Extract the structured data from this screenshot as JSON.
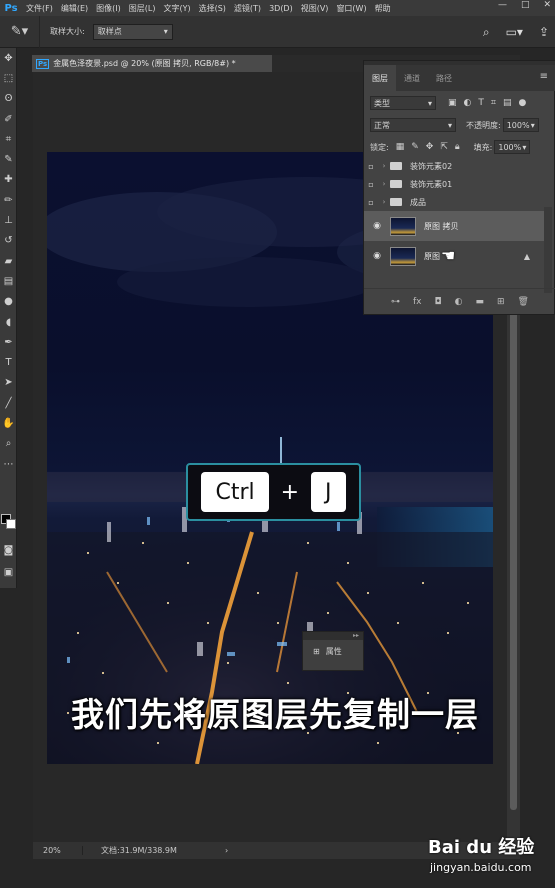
{
  "app": {
    "logo": "Ps",
    "menu": [
      "文件(F)",
      "编辑(E)",
      "图像(I)",
      "图层(L)",
      "文字(Y)",
      "选择(S)",
      "滤镜(T)",
      "3D(D)",
      "视图(V)",
      "窗口(W)",
      "帮助"
    ],
    "window_controls": [
      "—",
      "□",
      "✕"
    ]
  },
  "options_bar": {
    "tool_icon": "eyedropper-icon",
    "sample_size_label": "取样大小:",
    "sample_size_value": "取样点",
    "right_icons": [
      "search-icon",
      "workspace-icon",
      "share-icon"
    ]
  },
  "document": {
    "tab_title": "金属色泽夜景.psd @ 20% (原图 拷贝, RGB/8#) *",
    "zoom": "20%",
    "doc_info": "文档:31.9M/338.9M",
    "arrow": "›"
  },
  "layers_panel": {
    "tabs": [
      "图层",
      "通道",
      "路径"
    ],
    "active_tab": "图层",
    "filter_kind": "类型",
    "blend_mode": "正常",
    "opacity_label": "不透明度:",
    "opacity_value": "100%",
    "lock_label": "锁定:",
    "fill_label": "填充:",
    "fill_value": "100%",
    "groups": [
      {
        "name": "装饰元素02"
      },
      {
        "name": "装饰元素01"
      },
      {
        "name": "成品"
      }
    ],
    "layers": [
      {
        "name": "原图 拷贝",
        "selected": true
      },
      {
        "name": "原图",
        "selected": false,
        "locked": true
      }
    ]
  },
  "properties_panel": {
    "label": "属性"
  },
  "overlay": {
    "key1": "Ctrl",
    "plus": "+",
    "key2": "J"
  },
  "caption": "我们先将原图层先复制一层",
  "watermark": {
    "brand": "Bai du 经验",
    "site": "jingyan.baidu.com"
  }
}
